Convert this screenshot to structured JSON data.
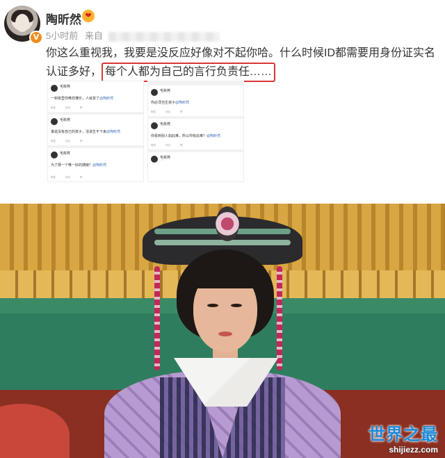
{
  "post": {
    "username": "陶昕然",
    "time": "5小时前",
    "source_prefix": "来自",
    "text_before": "你这么重视我，我要是没反应好像对不起你哈。什么时候ID都需要用身份证实名认证多好，",
    "text_highlight": "每个人都为自己的言行负责任……"
  },
  "embedded_comments": {
    "left": [
      {
        "name": "毛彬燕",
        "text": "一到夜里你唯恐懂乐，人就变了",
        "mention": "@陶昕然"
      },
      {
        "name": "毛彬燕",
        "text": "谁说没有自己的孩子，活该生不下来",
        "mention": "@陶昕然"
      },
      {
        "name": "毛彬燕",
        "text": "为了那一个唯一好的姨娘？",
        "mention": "@陶昕然"
      }
    ],
    "right": [
      {
        "name": "毛彬燕",
        "text": "你必须当生孩子",
        "mention": "@陶昕然"
      },
      {
        "name": "毛彬燕",
        "text": "你看到别人如此难，所以你有此难？",
        "mention": "@陶昕然"
      },
      {
        "name": "毛彬燕",
        "text": "",
        "mention": ""
      }
    ],
    "actions": [
      "转发",
      "评论",
      "赞"
    ]
  },
  "watermark": {
    "title": "世界之最",
    "domain": "shijiezz.com"
  },
  "colors": {
    "highlight_border": "#d93636",
    "mention": "#3b6fb5",
    "watermark": "#1d89d8",
    "verified": "#f28b1c"
  },
  "icons": {
    "verified": "verified-v-badge",
    "fan_badge": "fan-heart-badge"
  }
}
